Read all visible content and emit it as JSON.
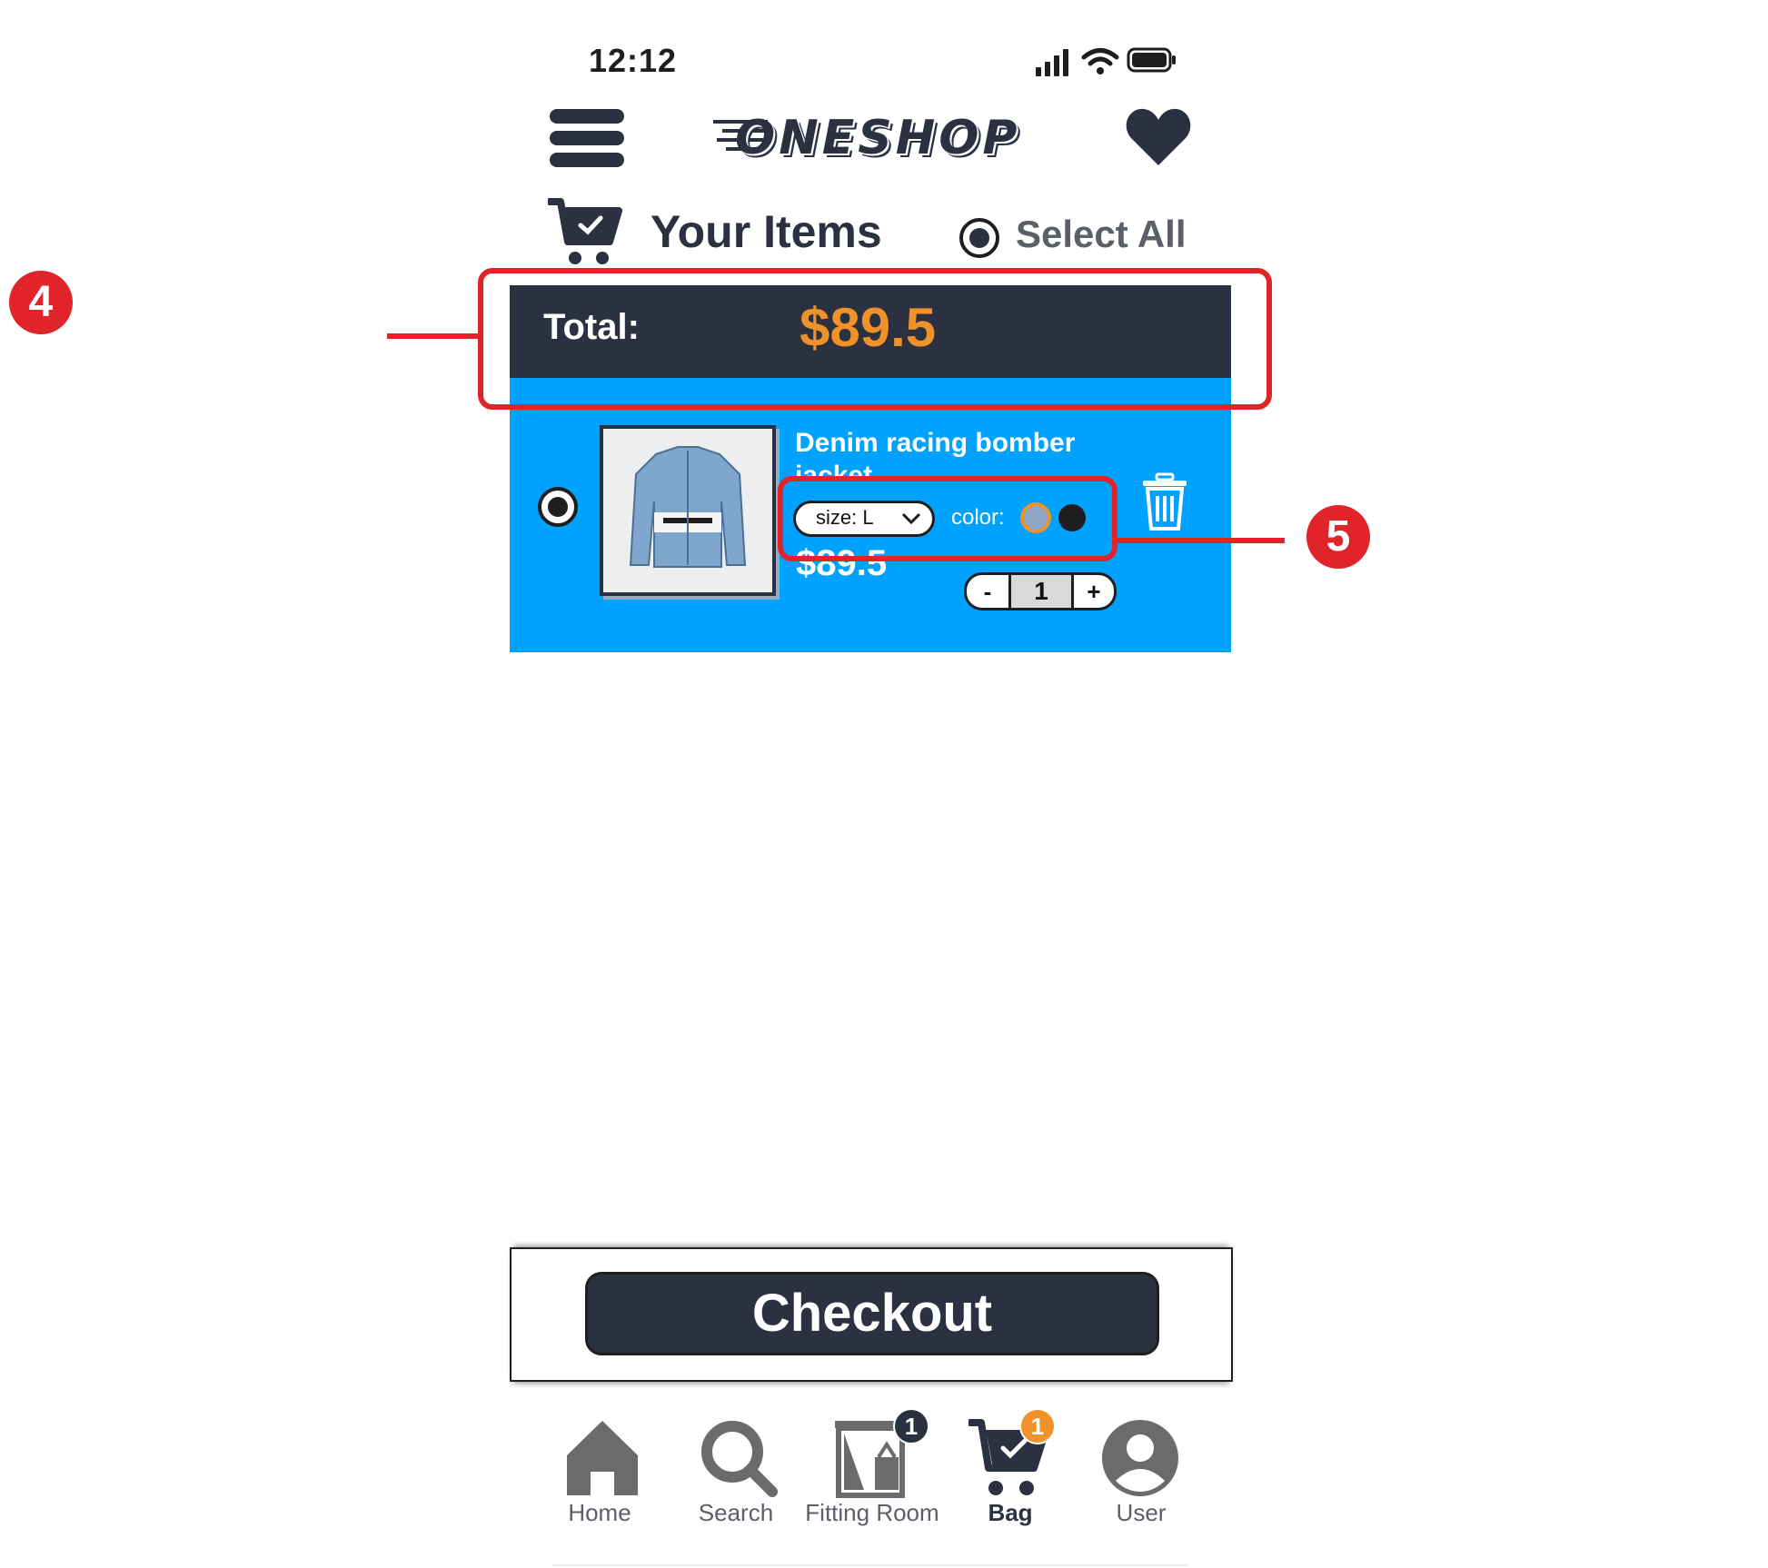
{
  "status_bar": {
    "time": "12:12"
  },
  "header": {
    "logo_text": "ONESHOP"
  },
  "cart": {
    "title": "Your Items",
    "select_all_label": "Select All"
  },
  "total": {
    "label": "Total:",
    "value": "$89.5"
  },
  "item": {
    "name": "Denim racing bomber jacket",
    "price": "$89.5",
    "size_text": "size: L",
    "color_label": "color:",
    "color_options": [
      "#8fa6c4",
      "#1e1e1e"
    ],
    "quantity": "1",
    "minus": "-",
    "plus": "+"
  },
  "checkout": {
    "label": "Checkout"
  },
  "annotations": {
    "a4": "4",
    "a5": "5"
  },
  "nav": {
    "home": "Home",
    "search": "Search",
    "fitting_room": "Fitting Room",
    "fitting_room_badge": "1",
    "bag": "Bag",
    "bag_badge": "1",
    "user": "User"
  },
  "colors": {
    "dark": "#2b3140",
    "accent_blue": "#00a2ff",
    "accent_orange": "#f0922a",
    "annotation_red": "#e0242a"
  }
}
